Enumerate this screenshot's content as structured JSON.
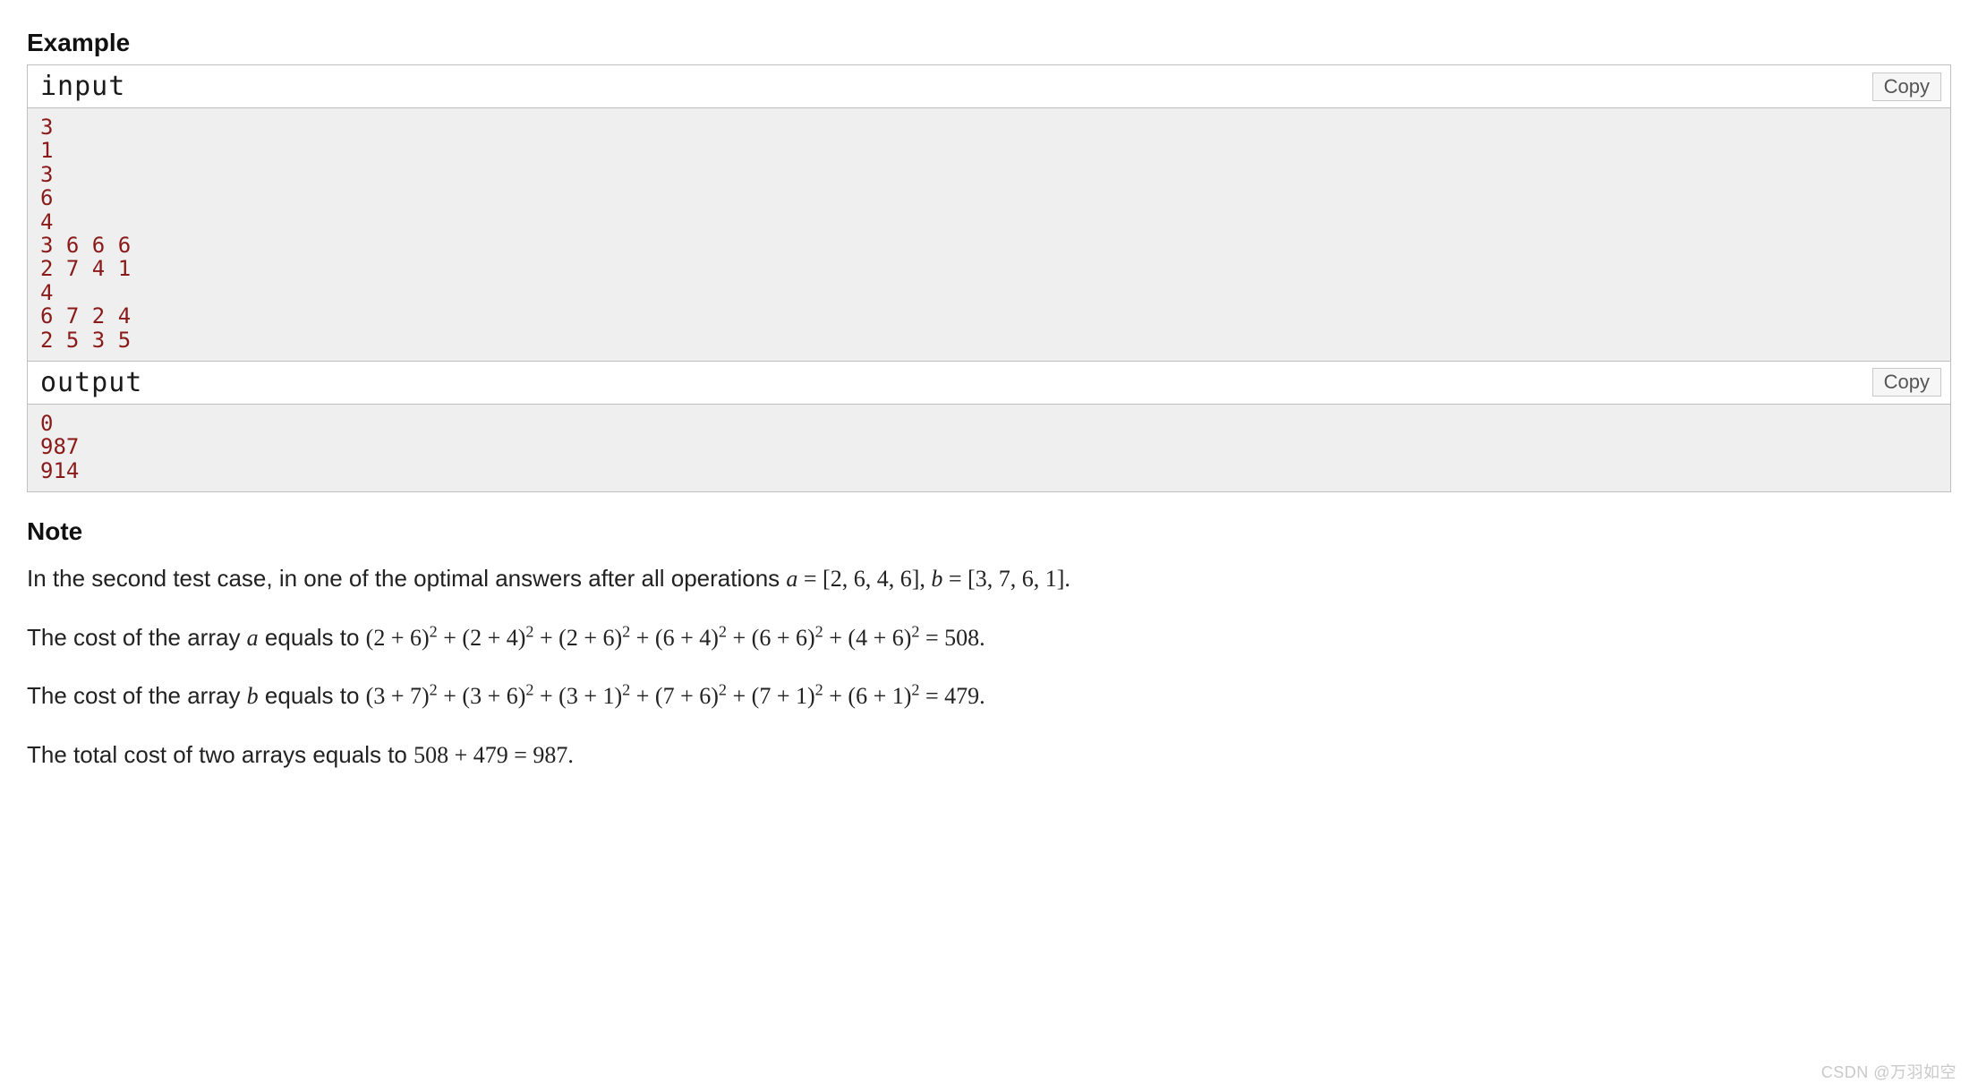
{
  "headings": {
    "example": "Example",
    "note": "Note"
  },
  "io": {
    "input_label": "input",
    "output_label": "output",
    "copy_label": "Copy",
    "input_text": "3\n1\n3\n6\n4\n3 6 6 6\n2 7 4 1\n4\n6 7 2 4\n2 5 3 5",
    "output_text": "0\n987\n914"
  },
  "note": {
    "p1_prefix": "In the second test case, in one of the optimal answers after all operations ",
    "p1_a_var": "a",
    "p1_eq1": " = [2, 6, 4, 6], ",
    "p1_b_var": "b",
    "p1_eq2": " = [3, 7, 6, 1].",
    "p2_prefix": "The cost of the array ",
    "p2_var": "a",
    "p2_mid": " equals to ",
    "p2_expr_terms": [
      "(2 + 6)",
      "(2 + 4)",
      "(2 + 6)",
      "(6 + 4)",
      "(6 + 6)",
      "(4 + 6)"
    ],
    "p2_result": " = 508.",
    "p3_prefix": "The cost of the array ",
    "p3_var": "b",
    "p3_mid": " equals to ",
    "p3_expr_terms": [
      "(3 + 7)",
      "(3 + 6)",
      "(3 + 1)",
      "(7 + 6)",
      "(7 + 1)",
      "(6 + 1)"
    ],
    "p3_result": " = 479.",
    "p4_prefix": "The total cost of two arrays equals to ",
    "p4_expr": "508 + 479 = 987."
  },
  "sup": "2",
  "plus": " + ",
  "watermark": "CSDN @万羽如空"
}
